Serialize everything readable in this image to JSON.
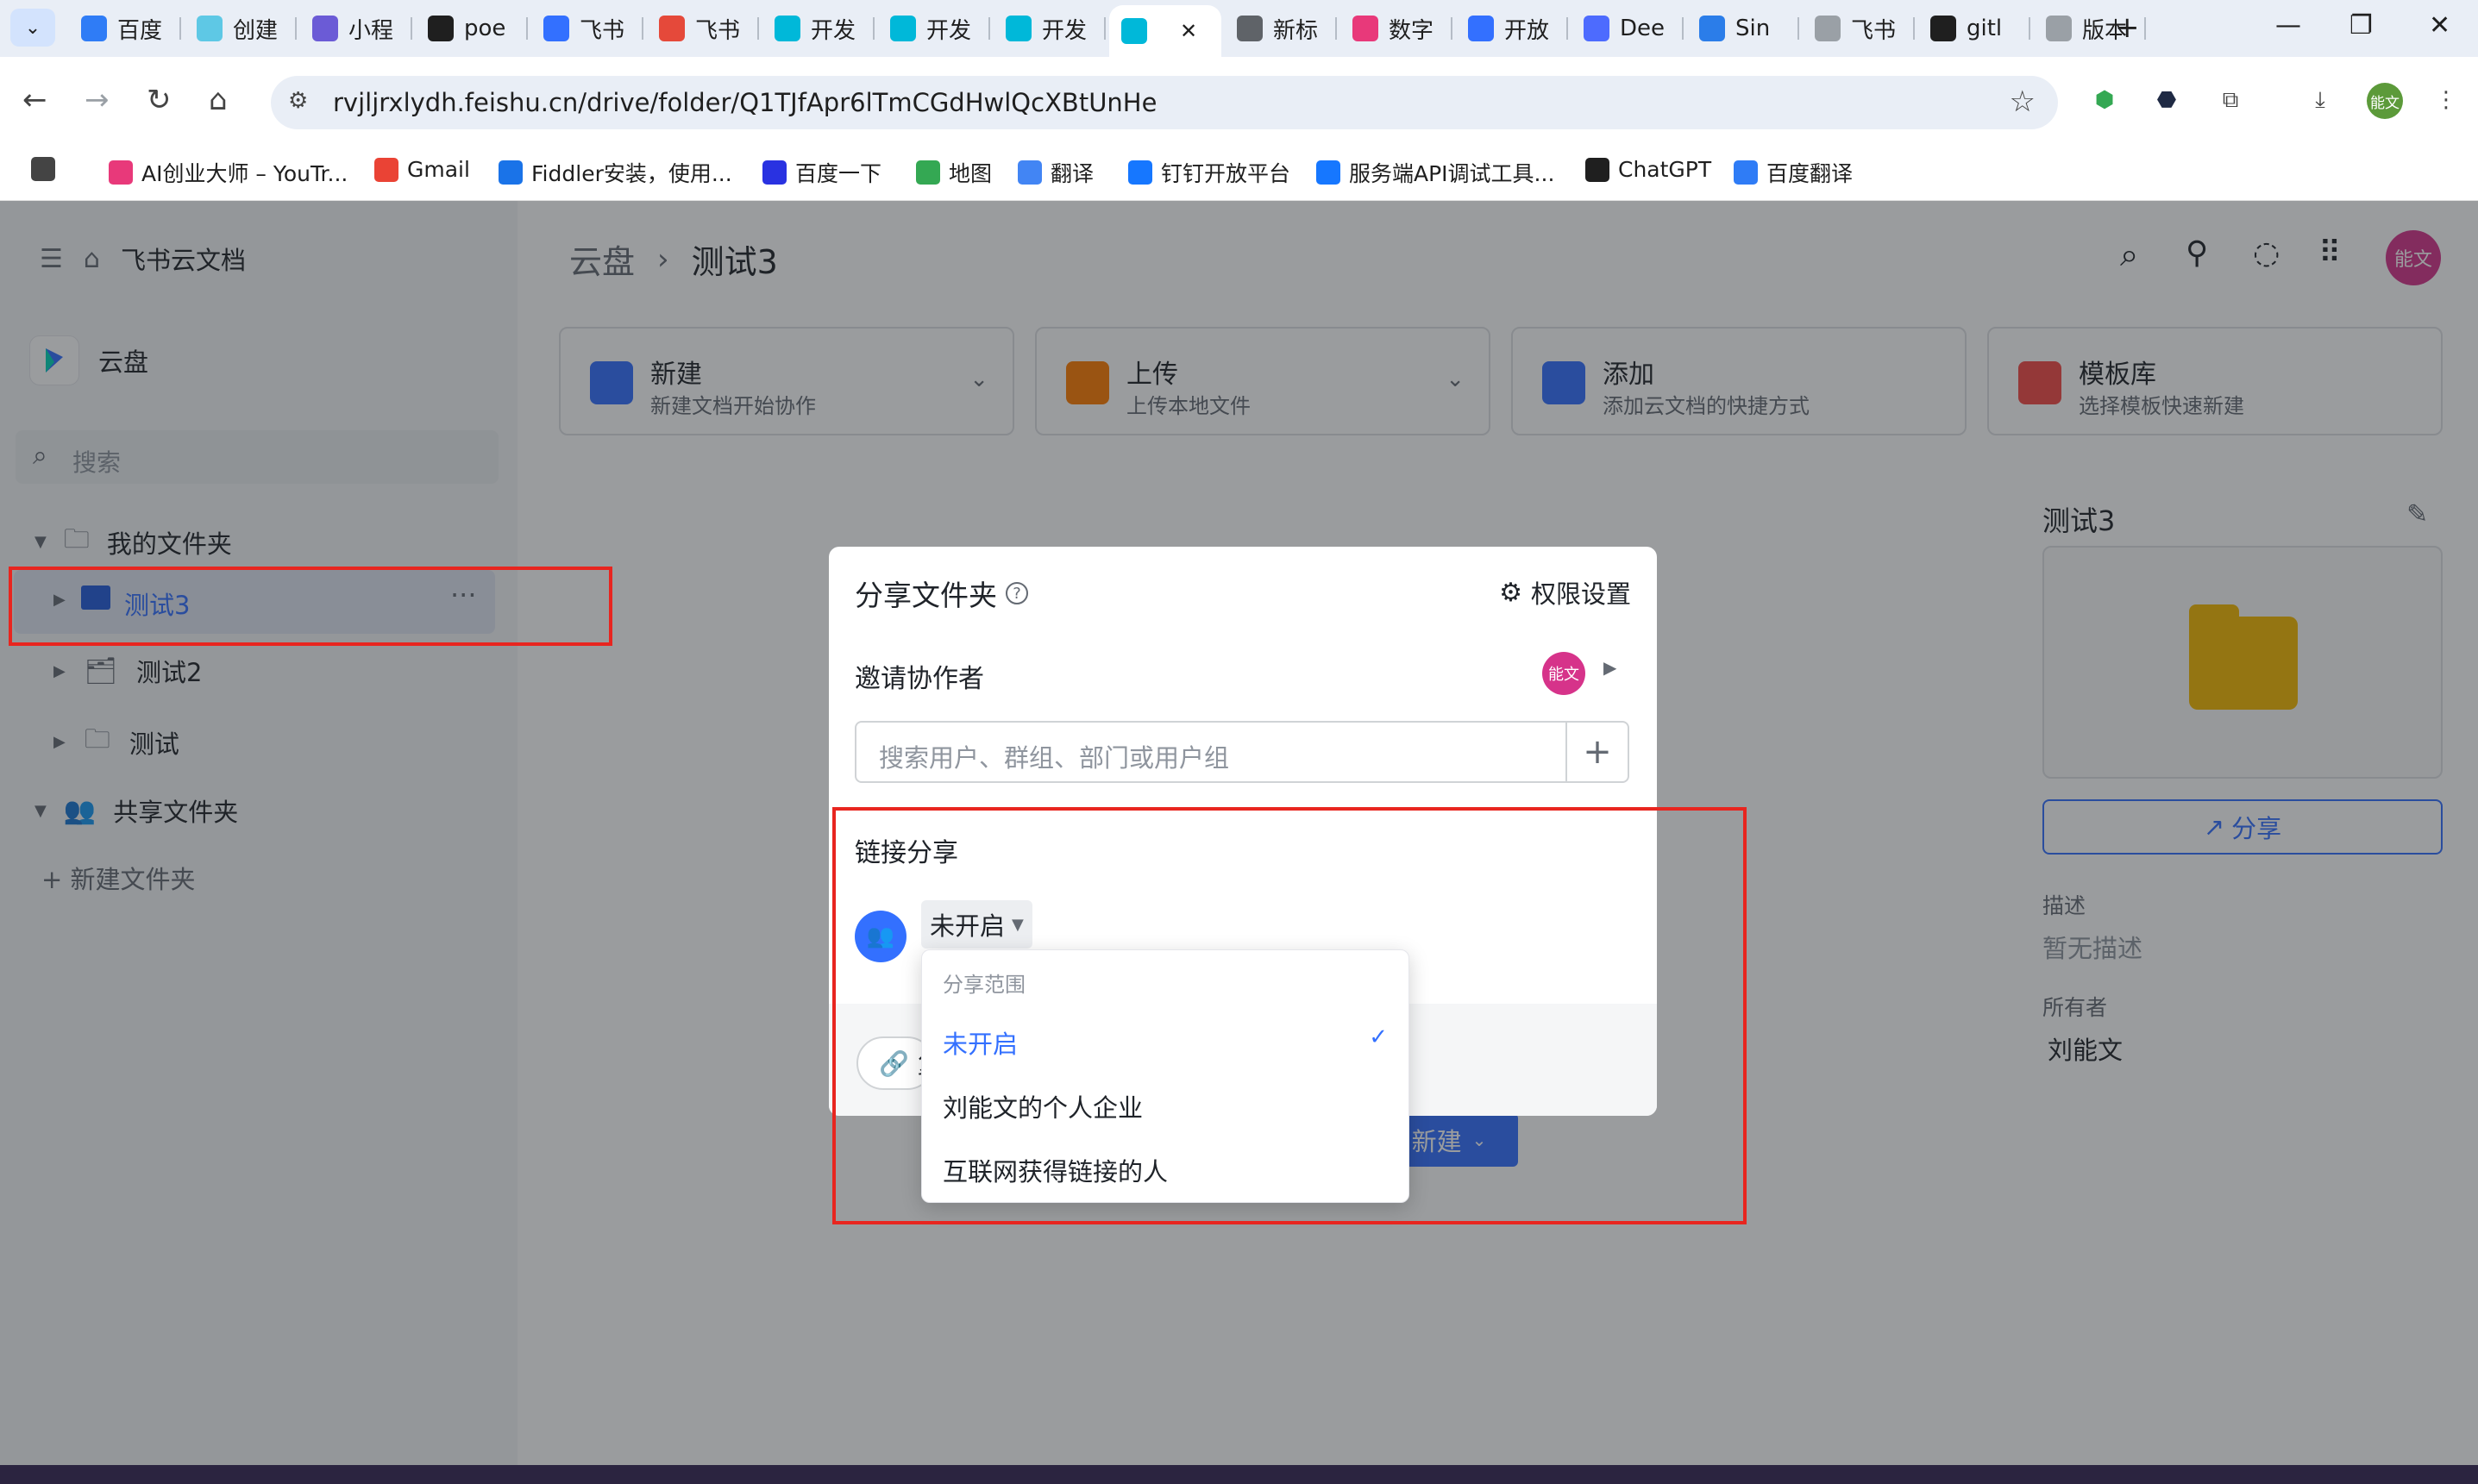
{
  "browser": {
    "tabs": [
      {
        "label": "百度",
        "icon": "translate-icon",
        "color": "#2f7cf6"
      },
      {
        "label": "创建",
        "icon": "react-icon",
        "color": "#5ec8e5"
      },
      {
        "label": "小程",
        "icon": "link-icon",
        "color": "#6b5bd6"
      },
      {
        "label": "poe",
        "icon": "poe-icon",
        "color": "#1f1f1f"
      },
      {
        "label": "飞书",
        "icon": "feishu-doc-icon",
        "color": "#3370ff"
      },
      {
        "label": "飞书",
        "icon": "robot-icon",
        "color": "#e5493a"
      },
      {
        "label": "开发",
        "icon": "feishu-icon",
        "color": "#00b8d9"
      },
      {
        "label": "开发",
        "icon": "feishu-icon",
        "color": "#00b8d9"
      },
      {
        "label": "开发",
        "icon": "feishu-icon",
        "color": "#00b8d9"
      },
      {
        "label": "",
        "icon": "feishu-icon",
        "color": "#00b8d9",
        "active": true
      },
      {
        "label": "新标",
        "icon": "chrome-icon",
        "color": "#5f6368"
      },
      {
        "label": "数字",
        "icon": "butterfly-icon",
        "color": "#e8397a"
      },
      {
        "label": "开放",
        "icon": "doc-icon",
        "color": "#3370ff"
      },
      {
        "label": "Dee",
        "icon": "deepseek-icon",
        "color": "#4d6bfe"
      },
      {
        "label": "Sin",
        "icon": "m-icon",
        "color": "#2b7de9"
      },
      {
        "label": "飞书",
        "icon": "bot-icon",
        "color": "#9aa0a6"
      },
      {
        "label": "gitl",
        "icon": "github-icon",
        "color": "#1f1f1f"
      },
      {
        "label": "版本",
        "icon": "globe-icon",
        "color": "#9aa0a6"
      }
    ],
    "url": "rvjljrxlydh.feishu.cn/drive/folder/Q1TJfApr6lTmCGdHwlQcXBtUnHe",
    "profile_label": "能文",
    "bookmarks": [
      {
        "label": "",
        "icon": "apps-grid-icon",
        "color": "#444"
      },
      {
        "label": "AI创业大师 – YouTr...",
        "icon": "butterfly-icon",
        "color": "#e8397a"
      },
      {
        "label": "Gmail",
        "icon": "gmail-icon",
        "color": "#ea4335"
      },
      {
        "label": "Fiddler安装，使用...",
        "icon": "fiddler-icon",
        "color": "#1a73e8"
      },
      {
        "label": "百度一下",
        "icon": "baidu-icon",
        "color": "#2932e1"
      },
      {
        "label": "地图",
        "icon": "map-pin-icon",
        "color": "#34a853"
      },
      {
        "label": "翻译",
        "icon": "google-translate-icon",
        "color": "#4285f4"
      },
      {
        "label": "钉钉开放平台",
        "icon": "dingtalk-icon",
        "color": "#1677ff"
      },
      {
        "label": "服务端API调试工具...",
        "icon": "dingtalk-icon",
        "color": "#1677ff"
      },
      {
        "label": "ChatGPT",
        "icon": "openai-icon",
        "color": "#1f1f1f"
      },
      {
        "label": "百度翻译",
        "icon": "translate-icon",
        "color": "#2f7cf6"
      }
    ]
  },
  "sidebar": {
    "header": "飞书云文档",
    "drive_label": "云盘",
    "search_placeholder": "搜索",
    "my_folders": "我的文件夹",
    "folders": [
      "测试3",
      "测试2",
      "测试"
    ],
    "shared_folders": "共享文件夹",
    "new_folder": "+ 新建文件夹"
  },
  "main": {
    "breadcrumb_root": "云盘",
    "breadcrumb_current": "测试3",
    "user_avatar": "能文",
    "cards": [
      {
        "title": "新建",
        "subtitle": "新建文档开始协作",
        "color": "#3370ff"
      },
      {
        "title": "上传",
        "subtitle": "上传本地文件",
        "color": "#ff7d00"
      },
      {
        "title": "添加",
        "subtitle": "添加云文档的快捷方式",
        "color": "#3370ff"
      },
      {
        "title": "模板库",
        "subtitle": "选择模板快速新建",
        "color": "#f54a45"
      }
    ],
    "new_button": "新建",
    "detail": {
      "title": "测试3",
      "share_button": "分享",
      "desc_label": "描述",
      "desc_value": "暂无描述",
      "owner_label": "所有者",
      "owner_value": "刘能文"
    }
  },
  "modal": {
    "title": "分享文件夹",
    "permission_settings": "权限设置",
    "invite_label": "邀请协作者",
    "invite_avatar": "能文",
    "search_placeholder": "搜索用户、群组、部门或用户组",
    "link_share_label": "链接分享",
    "link_status": "未开启",
    "copy_link_partial": "复"
  },
  "dropdown": {
    "header": "分享范围",
    "options": [
      "未开启",
      "刘能文的个人企业",
      "互联网获得链接的人"
    ],
    "selected_index": 0
  },
  "colors": {
    "accent": "#3370ff",
    "highlight_box": "#e8251f",
    "avatar_pink": "#d6338a"
  }
}
